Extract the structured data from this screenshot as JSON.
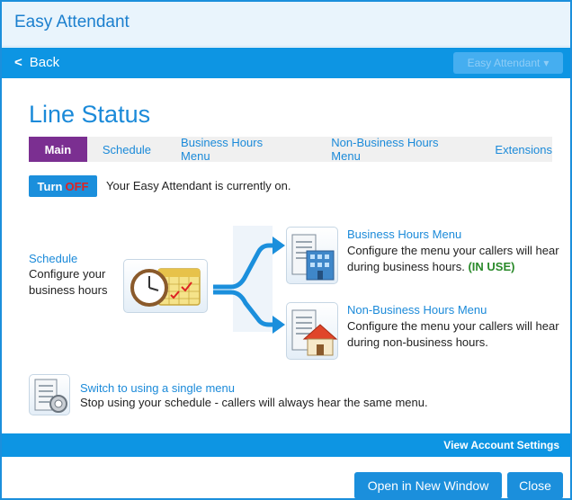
{
  "app": {
    "title": "Easy Attendant"
  },
  "nav": {
    "back_label": "Back",
    "dropdown_label": "Easy Attendant",
    "dropdown_caret": "▾"
  },
  "page": {
    "title": "Line Status"
  },
  "tabs": [
    {
      "label": "Main",
      "active": true
    },
    {
      "label": "Schedule",
      "active": false
    },
    {
      "label": "Business Hours Menu",
      "active": false
    },
    {
      "label": "Non-Business Hours Menu",
      "active": false
    },
    {
      "label": "Extensions",
      "active": false
    }
  ],
  "status": {
    "button_prefix": "Turn",
    "button_state": "OFF",
    "message": "Your Easy Attendant is currently on."
  },
  "schedule": {
    "link": "Schedule",
    "description": "Configure your business hours",
    "icon": "clock-calendar-icon"
  },
  "business_hours": {
    "link": "Business Hours Menu",
    "description": "Configure the menu your callers will hear during business hours.",
    "badge": "(IN USE)",
    "icon": "office-building-icon"
  },
  "non_business_hours": {
    "link": "Non-Business Hours Menu",
    "description": "Configure the menu your callers will hear during non-business hours.",
    "icon": "house-icon"
  },
  "single_menu": {
    "link": "Switch to using a single menu",
    "description": "Stop using your schedule - callers will always hear the same menu.",
    "icon": "single-menu-icon"
  },
  "footer": {
    "account_settings": "View Account Settings",
    "open_window": "Open in New Window",
    "close": "Close"
  },
  "colors": {
    "brand_blue": "#0d95e3",
    "active_tab": "#7b2f91",
    "off_red": "#e02222",
    "in_use_green": "#2a8a2a"
  }
}
